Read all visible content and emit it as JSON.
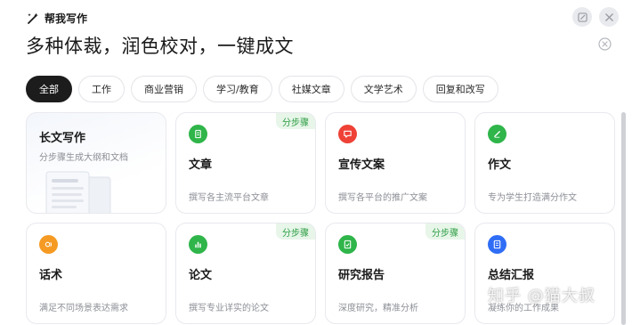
{
  "header": {
    "title": "帮我写作",
    "wand_icon": "magic-wand-icon"
  },
  "window_buttons": {
    "edit_icon": "edit-icon",
    "close_icon": "close-icon"
  },
  "headline": "多种体裁，润色校对，一键成文",
  "tabs": [
    {
      "label": "全部",
      "active": true
    },
    {
      "label": "工作"
    },
    {
      "label": "商业营销"
    },
    {
      "label": "学习/教育"
    },
    {
      "label": "社媒文章"
    },
    {
      "label": "文学艺术"
    },
    {
      "label": "回复和改写"
    }
  ],
  "cards": [
    {
      "name": "长文写作",
      "desc": "分步骤生成大纲和文档"
    },
    {
      "name": "文章",
      "desc": "撰写各主流平台文章",
      "badge": "分步骤",
      "icon": "document-icon",
      "color": "#2fb54a"
    },
    {
      "name": "宣传文案",
      "desc": "撰写各平台的推广文案",
      "icon": "chat-bubble-icon",
      "color": "#ef4135"
    },
    {
      "name": "作文",
      "desc": "专为学生打造满分作文",
      "icon": "pen-icon",
      "color": "#2fb54a"
    },
    {
      "name": "话术",
      "desc": "满足不同场景表达需求",
      "icon": "speaker-icon",
      "color": "#f59a23"
    },
    {
      "name": "论文",
      "desc": "撰写专业详实的论文",
      "badge": "分步骤",
      "icon": "bar-chart-icon",
      "color": "#2fb54a"
    },
    {
      "name": "研究报告",
      "desc": "深度研究，精准分析",
      "badge": "分步骤",
      "icon": "report-icon",
      "color": "#2fb54a"
    },
    {
      "name": "总结汇报",
      "desc": "凝练你的工作成果",
      "icon": "summary-icon",
      "color": "#2f6df6"
    }
  ],
  "watermark": "知乎 @猫大叔"
}
